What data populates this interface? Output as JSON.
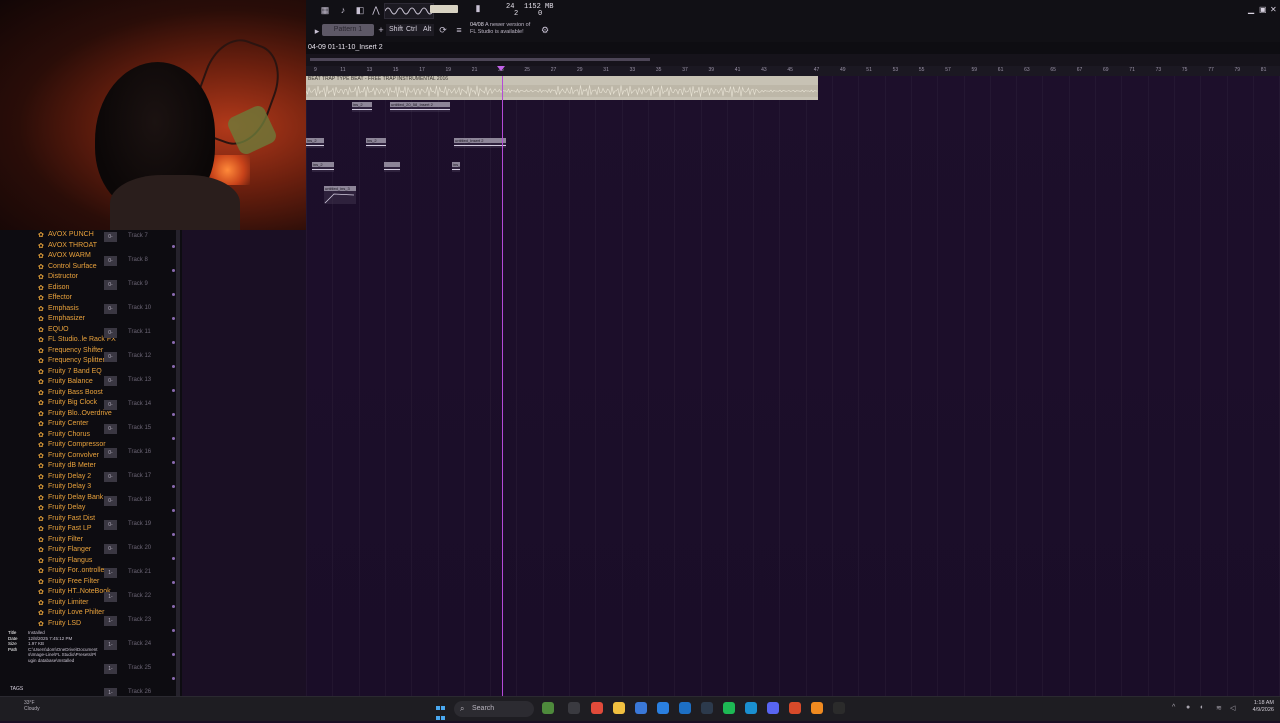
{
  "webcam": {},
  "toolbar": {
    "counter_a": "24",
    "counter_b": "2",
    "memory": "1152 MB",
    "memory_sub": "0",
    "pattern": "Pattern 1",
    "keys": [
      "Shift",
      "Ctrl",
      "Alt"
    ],
    "news_date": "04/08",
    "news_text": "A newer version of",
    "news_text2": "FL Studio is available!"
  },
  "playlist": {
    "title": "04-09 01-11-10_Insert 2",
    "ruler": [
      "9",
      "11",
      "13",
      "15",
      "17",
      "19",
      "21",
      "23",
      "25",
      "27",
      "29",
      "31",
      "33",
      "35",
      "37",
      "39",
      "41",
      "43",
      "45",
      "47",
      "49",
      "51",
      "53",
      "55",
      "57",
      "59",
      "61",
      "63",
      "65",
      "67",
      "69",
      "71",
      "73",
      "75",
      "77",
      "79",
      "81",
      "83"
    ],
    "main_clip_label": "BEAT TRAP TYPE BEAT - FREE TRAP INSTRUMENTAL 2016",
    "clips": [
      {
        "label": "ins_2"
      },
      {
        "label": "untitled_20_58_Insert 2"
      },
      {
        "label": "ins_2"
      },
      {
        "label": "ins_2"
      },
      {
        "label": "untitled_Insert 2"
      },
      {
        "label": "ins_2"
      },
      {
        "label": ""
      },
      {
        "label": "ins_2"
      },
      {
        "label": "untitled_ins_3"
      }
    ]
  },
  "browser": {
    "plugins": [
      "AVOX PUNCH",
      "AVOX THROAT",
      "AVOX WARM",
      "Control Surface",
      "Distructor",
      "Edison",
      "Effector",
      "Emphasis",
      "Emphasizer",
      "EQUO",
      "FL Studio..le Rack FX",
      "Frequency Shifter",
      "Frequency Splitter",
      "Fruity 7 Band EQ",
      "Fruity Balance",
      "Fruity Bass Boost",
      "Fruity Big Clock",
      "Fruity Blo..Overdrive",
      "Fruity Center",
      "Fruity Chorus",
      "Fruity Compressor",
      "Fruity Convolver",
      "Fruity dB Meter",
      "Fruity Delay 2",
      "Fruity Delay 3",
      "Fruity Delay Bank",
      "Fruity Delay",
      "Fruity Fast Dist",
      "Fruity Fast LP",
      "Fruity Filter",
      "Fruity Flanger",
      "Fruity Flangus",
      "Fruity For..ontroller",
      "Fruity Free Filter",
      "Fruity HT..NoteBook",
      "Fruity Limiter",
      "Fruity Love Philter",
      "Fruity LSD"
    ],
    "tracks": [
      {
        "name": "Track 7",
        "mix": "0-"
      },
      {
        "name": "Track 8",
        "mix": "0-"
      },
      {
        "name": "Track 9",
        "mix": "0-"
      },
      {
        "name": "Track 10",
        "mix": "0-"
      },
      {
        "name": "Track 11",
        "mix": "0-"
      },
      {
        "name": "Track 12",
        "mix": "0-"
      },
      {
        "name": "Track 13",
        "mix": "0-"
      },
      {
        "name": "Track 14",
        "mix": "0-"
      },
      {
        "name": "Track 15",
        "mix": "0-"
      },
      {
        "name": "Track 16",
        "mix": "0-"
      },
      {
        "name": "Track 17",
        "mix": "0-"
      },
      {
        "name": "Track 18",
        "mix": "0-"
      },
      {
        "name": "Track 19",
        "mix": "0-"
      },
      {
        "name": "Track 20",
        "mix": "0-"
      },
      {
        "name": "Track 21",
        "mix": "1-"
      },
      {
        "name": "Track 22",
        "mix": "1-"
      },
      {
        "name": "Track 23",
        "mix": "1-"
      },
      {
        "name": "Track 24",
        "mix": "1-"
      },
      {
        "name": "Track 25",
        "mix": "1-"
      },
      {
        "name": "Track 26",
        "mix": "1-"
      }
    ],
    "info": {
      "title_k": "Title",
      "title_v": "Installed",
      "date_k": "Date",
      "date_v": "12/8/2025 7:45:12 PM",
      "size_k": "Size",
      "size_v": "1.97 KB",
      "path_k": "Path",
      "path_v": "C:\\Users\\dom\\OneDrive\\Documents\\Image-Line\\FL Studio\\Presets\\Plugin database\\Installed"
    },
    "tags_label": "TAGS"
  },
  "taskbar": {
    "weather_temp": "33°F",
    "weather_text": "Cloudy",
    "search": "Search",
    "time": "1:18 AM",
    "date": "4/9/2026"
  },
  "colors": {
    "playlist_bg": "#1d0f2b",
    "plugin_text": "#e9a23c",
    "playhead": "#b44ad8"
  }
}
